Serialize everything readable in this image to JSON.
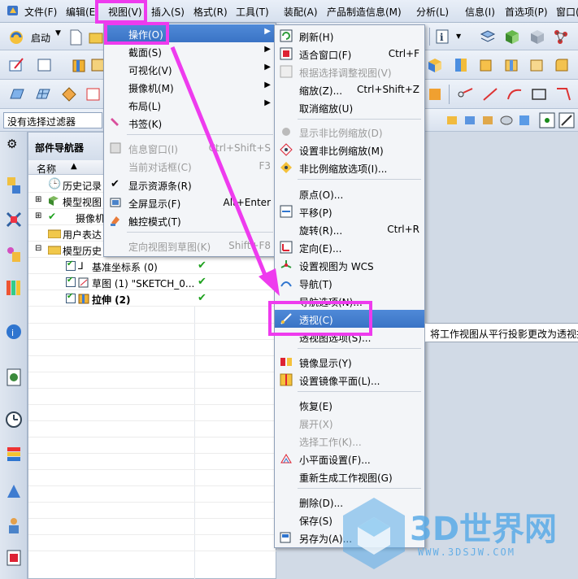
{
  "menubar": {
    "items": [
      "文件(F)",
      "编辑(E)",
      "视图(V)",
      "插入(S)",
      "格式(R)",
      "工具(T)",
      "装配(A)",
      "产品制造信息(M)",
      "分析(L)",
      "信息(I)",
      "首选项(P)",
      "窗口("
    ]
  },
  "toolbar": {
    "start_label": "启动"
  },
  "filter": {
    "value": "没有选择过滤器"
  },
  "navigator": {
    "title": "部件导航器",
    "column_name": "名称",
    "rows": [
      {
        "label": "历史记录"
      },
      {
        "label": "模型视图"
      },
      {
        "label": "摄像机"
      },
      {
        "label": "用户表达"
      },
      {
        "label": "模型历史"
      },
      {
        "label": "基准坐标系 (0)"
      },
      {
        "label": "草图 (1) \"SKETCH_0..."
      },
      {
        "label": "拉伸 (2)"
      }
    ]
  },
  "view_menu": {
    "items": [
      {
        "label": "操作(O)"
      },
      {
        "label": "截面(S)"
      },
      {
        "label": "可视化(V)"
      },
      {
        "label": "摄像机(M)"
      },
      {
        "label": "布局(L)"
      },
      {
        "label": "书签(K)"
      },
      {
        "label": "信息窗口(I)",
        "shortcut": "Ctrl+Shift+S"
      },
      {
        "label": "当前对话框(C)",
        "shortcut": "F3"
      },
      {
        "label": "显示资源条(R)"
      },
      {
        "label": "全屏显示(F)",
        "shortcut": "Alt+Enter"
      },
      {
        "label": "触控模式(T)"
      },
      {
        "label": "定向视图到草图(K)",
        "shortcut": "Shift+F8"
      }
    ]
  },
  "ops_menu": {
    "items": [
      {
        "label": "刷新(H)"
      },
      {
        "label": "适合窗口(F)",
        "shortcut": "Ctrl+F"
      },
      {
        "label": "根据选择调整视图(V)"
      },
      {
        "label": "缩放(Z)...",
        "shortcut": "Ctrl+Shift+Z"
      },
      {
        "label": "取消缩放(U)"
      },
      {
        "label": "显示非比例缩放(D)"
      },
      {
        "label": "设置非比例缩放(M)"
      },
      {
        "label": "非比例缩放选项(I)..."
      },
      {
        "label": "原点(O)..."
      },
      {
        "label": "平移(P)"
      },
      {
        "label": "旋转(R)...",
        "shortcut": "Ctrl+R"
      },
      {
        "label": "定向(E)..."
      },
      {
        "label": "设置视图为 WCS"
      },
      {
        "label": "导航(T)"
      },
      {
        "label": "导航选项(N)..."
      },
      {
        "label": "透视(C)"
      },
      {
        "label": "透视图选项(S)..."
      },
      {
        "label": "镜像显示(Y)"
      },
      {
        "label": "设置镜像平面(L)..."
      },
      {
        "label": "恢复(E)"
      },
      {
        "label": "展开(X)"
      },
      {
        "label": "选择工作(K)..."
      },
      {
        "label": "小平面设置(F)..."
      },
      {
        "label": "重新生成工作视图(G)"
      },
      {
        "label": "删除(D)..."
      },
      {
        "label": "保存(S)"
      },
      {
        "label": "另存为(A)..."
      }
    ]
  },
  "tooltip": {
    "text": "将工作视图从平行投影更改为透视投影"
  },
  "watermark": {
    "text": "3D世界网",
    "url": "WWW.3DSJW.COM"
  }
}
